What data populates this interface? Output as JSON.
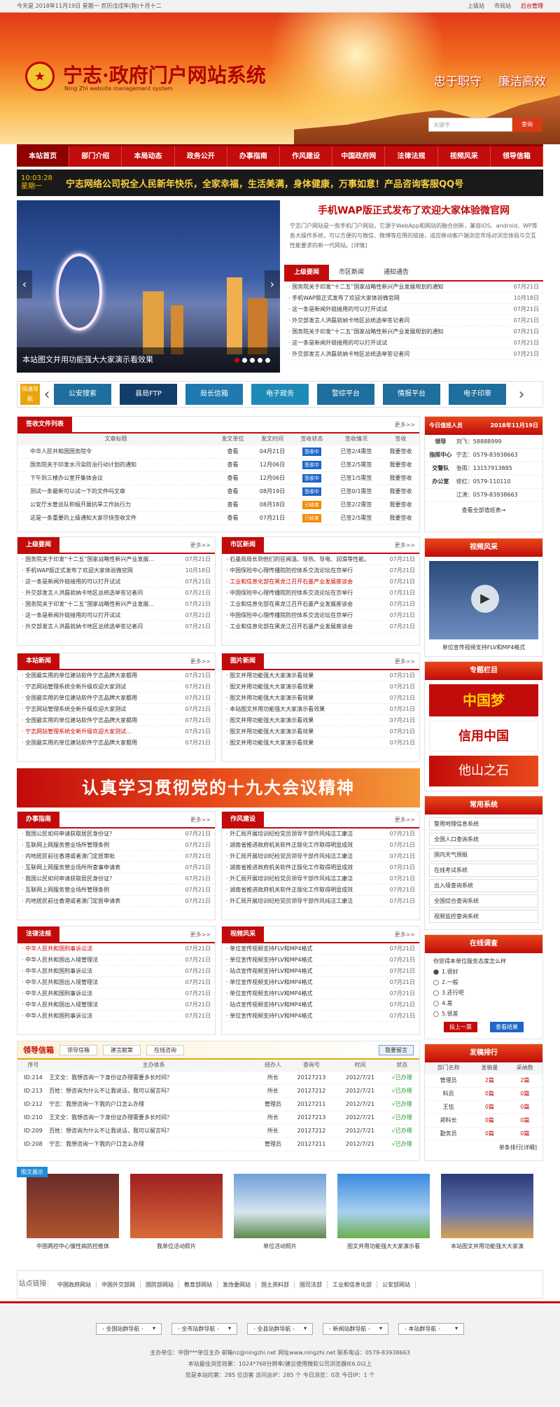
{
  "topbar": {
    "date": "今天是 2018年11月19日 星期一 农历戊戌年(狗)十月十二",
    "links": [
      "上级站",
      "市局站",
      "后台管理"
    ]
  },
  "header": {
    "title": "宁志·政府门户网站系统",
    "subtitle": "Ning Zhi website management system",
    "slogan1": "忠于职守",
    "slogan2": "廉洁高效",
    "search_placeholder": "关键字",
    "search_btn": "查询",
    "emblem": "★"
  },
  "nav": [
    "本站首页",
    "部门介绍",
    "本局动态",
    "政务公开",
    "办事指南",
    "作风建设",
    "中国政府网",
    "法律法规",
    "视频风采",
    "领导信箱"
  ],
  "ticker": {
    "time": "10:03:28",
    "day": "星期一",
    "message": "宁志网络公司祝全人民新年快乐，全家幸福，生活美满，身体健康，万事如意！产品咨询客服QQ号"
  },
  "slider": {
    "caption": "本站图文并用功能强大大家演示看效果",
    "prev": "‹",
    "next": "›"
  },
  "headline": {
    "title": "手机WAP版正式发布了欢迎大家体验微官网",
    "summary": "宁志门户网站是一款手机门户网站，它源于WebApp和网站的融合创新，兼容iOS、android、WP等各大操作系统，可以方便的与微信、微博等应用的链接，适应移动客户端浏览市场对浏览体验与交互性能要求的新一代网站。[详情]"
  },
  "headtabs": [
    "上级要闻",
    "市区新闻",
    "通知通告"
  ],
  "headlist": [
    {
      "t": "国务院关于印发“十二五”国家战略性新兴产业发展规划的通知",
      "d": "07月21日"
    },
    {
      "t": "手机WAP版正式发布了欢迎大家体验微官网",
      "d": "10月18日"
    },
    {
      "t": "这一条是新闻外链接用的可以打开试试",
      "d": "07月21日"
    },
    {
      "t": "外交部发言人洪磊就纳卡地区总统选举答记者问",
      "d": "07月21日"
    },
    {
      "t": "国务院关于印发“十二五”国家战略性新兴产业发展规划的通知",
      "d": "07月21日"
    },
    {
      "t": "这一条是新闻外链接用的可以打开试试",
      "d": "07月21日"
    },
    {
      "t": "外交部发言人洪磊就纳卡地区总统选举答记者问",
      "d": "07月21日"
    }
  ],
  "quick": {
    "label": "快速导航",
    "prev": "‹",
    "next": "›",
    "items": [
      "公安搜索",
      "县局FTP",
      "局长信箱",
      "电子政务",
      "警综平台",
      "情报平台",
      "电子印章"
    ]
  },
  "docs": {
    "title": "签收文件列表",
    "more": "更多>>",
    "cols": [
      "文章标题",
      "发文单位",
      "发文时间",
      "签收状态",
      "签收情况",
      "签收"
    ],
    "rows": [
      {
        "t": "中华人民共和国国务院令",
        "u": "查看",
        "d": "04月21日",
        "s": "签收中",
        "c": "已签2/4需签",
        "a": "我要签收",
        "sc": "#1e66c8"
      },
      {
        "t": "国务院关于印发水污染防治行动计划的通知",
        "u": "查看",
        "d": "12月06日",
        "s": "签收中",
        "c": "已签2/5需签",
        "a": "我要签收",
        "sc": "#1e66c8"
      },
      {
        "t": "下午到三楼办公室开集体会议",
        "u": "查看",
        "d": "12月06日",
        "s": "签收中",
        "c": "已签1/5需签",
        "a": "我要签收",
        "sc": "#1e66c8"
      },
      {
        "t": "测试一条最新可以试一下的文件吗文章",
        "u": "查看",
        "d": "08月19日",
        "s": "签收中",
        "c": "已签0/1需签",
        "a": "我要签收",
        "sc": "#1e66c8"
      },
      {
        "t": "公安厅水管总队积极开展抗旱工作执行力",
        "u": "查看",
        "d": "08月18日",
        "s": "已结束",
        "c": "已签2/2需签",
        "a": "我要签收",
        "sc": "#f08a00"
      },
      {
        "t": "这是一条重要的上级通知大家尽快签收文件",
        "u": "查看",
        "d": "07月21日",
        "s": "已结束",
        "c": "已签2/5需签",
        "a": "我要签收",
        "sc": "#f08a00"
      }
    ]
  },
  "duty": {
    "title": "今日值班人员",
    "date": "2018年11月19日",
    "more": "查看全部值班表→",
    "rows": [
      [
        "领导",
        "刘飞：58888999"
      ],
      [
        "指挥中心",
        "宁志：0579-83938663"
      ],
      [
        "交警队",
        "张雨：13157913885"
      ],
      [
        "办公室",
        "徐红：0579-110110"
      ],
      [
        "",
        "江涛：0579-83938663"
      ]
    ]
  },
  "sec1": {
    "title": "上级要闻",
    "more": "更多>>",
    "items": [
      {
        "t": "国务院关于印发“十二五”国家战略性新兴产业发展...",
        "d": "07月21日"
      },
      {
        "t": "手机WAP版正式发布了欢迎大家体验微官网",
        "d": "10月18日"
      },
      {
        "t": "这一条是新闻外链接用的可以打开试试",
        "d": "07月21日"
      },
      {
        "t": "外交部发言人洪磊就纳卡地区总统选举答记者问",
        "d": "07月21日"
      },
      {
        "t": "国务院关于印发“十二五”国家战略性新兴产业发展...",
        "d": "07月21日"
      },
      {
        "t": "这一条是新闻外链接用的可以打开试试",
        "d": "07月21日"
      },
      {
        "t": "外交部发言人洪磊就纳卡地区总统选举答记者问",
        "d": "07月21日"
      }
    ]
  },
  "sec2": {
    "title": "市区新闻",
    "more": "更多>>",
    "items": [
      {
        "t": "石墨局局长到他们的驻闻温、导热、导电、润滑等性能。",
        "d": "07月21日"
      },
      {
        "t": "中国保险中心理传播院防控体系交流论坛在京举行",
        "d": "07月21日"
      },
      {
        "t": "工业和信息化部在黑龙江召开石墨产业发展座谈会",
        "d": "07月21日",
        "red": true
      },
      {
        "t": "中国保险中心理传播院防控体系交流论坛在京举行",
        "d": "07月21日"
      },
      {
        "t": "工业和信息化部在黑龙江召开石墨产业发展座谈会",
        "d": "07月21日"
      },
      {
        "t": "中国保险中心理传播院防控体系交流论坛在京举行",
        "d": "07月21日"
      },
      {
        "t": "工业和信息化部在黑龙江召开石墨产业发展座谈会",
        "d": "07月21日"
      }
    ]
  },
  "sec3": {
    "title": "本站新闻",
    "more": "更多>>",
    "items": [
      {
        "t": "全国最实用的单位建站软件宁志品牌大家都用",
        "d": "07月21日"
      },
      {
        "t": "宁志网站管理系统全新升级欢迎大家测试",
        "d": "07月21日"
      },
      {
        "t": "全国最实用的单位建站软件宁志品牌大家都用",
        "d": "07月21日"
      },
      {
        "t": "宁志网站管理系统全新升级欢迎大家测试",
        "d": "07月21日"
      },
      {
        "t": "全国最实用的单位建站软件宁志品牌大家都用",
        "d": "07月21日"
      },
      {
        "t": "宁志网站管理系统全新升级欢迎大家测试...",
        "d": "07月21日",
        "red": true
      },
      {
        "t": "全国最实用的单位建站软件宁志品牌大家都用",
        "d": "07月21日"
      }
    ]
  },
  "sec4": {
    "title": "图片新闻",
    "more": "更多>>",
    "items": [
      {
        "t": "图文并用功能强大大家演示看效果",
        "d": "07月21日"
      },
      {
        "t": "图文并用功能强大大家演示看效果",
        "d": "07月21日"
      },
      {
        "t": "图文并用功能强大大家演示看效果",
        "d": "07月21日"
      },
      {
        "t": "本站图文并用功能强大大家演示看效果",
        "d": "07月21日"
      },
      {
        "t": "图文并用功能强大大家演示看效果",
        "d": "07月21日"
      },
      {
        "t": "图文并用功能强大大家演示看效果",
        "d": "07月21日"
      },
      {
        "t": "图文并用功能强大大家演示看效果",
        "d": "07月21日"
      }
    ]
  },
  "banner": "认真学习贯彻党的十九大会议精神",
  "video": {
    "title": "视频风采",
    "caption": "单位宣传视频支持FLV和MP4格式",
    "play": "▶"
  },
  "topics": {
    "title": "专题栏目",
    "items": [
      "中国梦",
      "信用中国",
      "他山之石"
    ]
  },
  "systems": {
    "title": "常用系统",
    "items": [
      "警用地理信息系统",
      "全国人口查询系统",
      "国内天气预报",
      "在线考试系统",
      "出入境查询系统",
      "全国综合查询系统",
      "视频监控查询系统"
    ]
  },
  "sec5": {
    "title": "办事指南",
    "more": "更多>>",
    "items": [
      {
        "t": "我国公民如何申请获取居民身份证？",
        "d": "07月21日"
      },
      {
        "t": "互联网上网服务营业场所管理条例",
        "d": "07月21日"
      },
      {
        "t": "内地居民前往香港或者澳门定居审批",
        "d": "07月21日"
      },
      {
        "t": "互联网上网服务营业场所所查事申请表",
        "d": "07月21日"
      },
      {
        "t": "我国公民如何申请获取居民身份证？",
        "d": "07月21日"
      },
      {
        "t": "互联网上网服务营业场所管理条例",
        "d": "07月21日"
      },
      {
        "t": "内地居民前往香港或者澳门定居申请表",
        "d": "07月21日"
      }
    ]
  },
  "sec6": {
    "title": "作风建设",
    "more": "更多>>",
    "items": [
      {
        "t": "外汇局开展培训纪检党员领导干部作风纯洁工康洁",
        "d": "07月21日"
      },
      {
        "t": "湖南省推进政府机关软件正版化工作取得明显成效",
        "d": "07月21日"
      },
      {
        "t": "外汇局开展培训纪检党员领导干部作风纯洁工康洁",
        "d": "07月21日"
      },
      {
        "t": "湖南省推进政府机关软件正版化工作取得明显成效",
        "d": "07月21日"
      },
      {
        "t": "外汇局开展培训纪检党员领导干部作风纯洁工康洁",
        "d": "07月21日"
      },
      {
        "t": "湖南省推进政府机关软件正版化工作取得明显成效",
        "d": "07月21日"
      },
      {
        "t": "外汇局开展培训纪检党员领导干部作风纯洁工康洁",
        "d": "07月21日"
      }
    ]
  },
  "sec7": {
    "title": "法律法规",
    "more": "更多>>",
    "items": [
      {
        "t": "中华人民共和国刑事诉讼法",
        "d": "07月21日",
        "red": true
      },
      {
        "t": "中华人民共和国出入境管理法",
        "d": "07月21日"
      },
      {
        "t": "中华人民共和国刑事诉讼法",
        "d": "07月21日"
      },
      {
        "t": "中华人民共和国出入境管理法",
        "d": "07月21日"
      },
      {
        "t": "中华人民共和国刑事诉讼法",
        "d": "07月21日"
      },
      {
        "t": "中华人民共和国出入境管理法",
        "d": "07月21日"
      },
      {
        "t": "中华人民共和国刑事诉讼法",
        "d": "07月21日"
      }
    ]
  },
  "sec8": {
    "title": "视频风采",
    "more": "更多>>",
    "items": [
      {
        "t": "单位宣传视频支持FLV和MP4格式",
        "d": "07月21日"
      },
      {
        "t": "单位宣传视频支持FLV和MP4格式",
        "d": "07月21日"
      },
      {
        "t": "站点宣传视频支持FLV和MP4格式",
        "d": "07月21日"
      },
      {
        "t": "单位宣传视频支持FLV和MP4格式",
        "d": "07月21日"
      },
      {
        "t": "单位宣传视频支持FLV和MP4格式",
        "d": "07月21日"
      },
      {
        "t": "站点宣传视频支持FLV和MP4格式",
        "d": "07月21日"
      },
      {
        "t": "单位宣传视频支持FLV和MP4格式",
        "d": "07月21日"
      }
    ]
  },
  "survey": {
    "title": "在线调查",
    "question": "你觉得本单位服务态度怎么样",
    "options": [
      "1.很好",
      "2.一般",
      "3.还行吧",
      "4.差",
      "5.很差"
    ],
    "submit": "投上一票",
    "view": "查看结果"
  },
  "mailbox": {
    "title": "领导信箱",
    "tabs": [
      "领导信箱",
      "建言献策",
      "在线咨询"
    ],
    "write": "我要留言",
    "cols": [
      "序号",
      "主办体系",
      "结办人",
      "查询号",
      "时间",
      "状态"
    ],
    "rows": [
      [
        "ID:214",
        "王文全：我想咨询一下身份证办理需要多长时间？",
        "所长",
        "20127213",
        "2012/7/21",
        "√已办理"
      ],
      [
        "ID:213",
        "百姓：想咨询为什么不让我说话，我可以留言吗？",
        "所长",
        "20127212",
        "2012/7/21",
        "√已办理"
      ],
      [
        "ID:212",
        "宁志：我想咨询一下我的户口怎么办理",
        "管理员",
        "20127211",
        "2012/7/21",
        "√已办理"
      ],
      [
        "ID:210",
        "王文全：我想咨询一下身份证办理需要多长时间？",
        "所长",
        "20127213",
        "2012/7/21",
        "√已办理"
      ],
      [
        "ID:209",
        "百姓：想咨询为什么不让我说话，我可以留言吗？",
        "所长",
        "20127212",
        "2012/7/21",
        "√已办理"
      ],
      [
        "ID:208",
        "宁志：我想咨询一下我的户口怎么办理",
        "管理员",
        "20127211",
        "2012/7/21",
        "√已办理"
      ]
    ]
  },
  "ranking": {
    "title": "发稿排行",
    "cols": [
      "部门名称",
      "发稿量",
      "采纳数"
    ],
    "rows": [
      [
        "管理员",
        "2篇",
        "2篇"
      ],
      [
        "科员",
        "0篇",
        "0篇"
      ],
      [
        "王伍",
        "0篇",
        "0篇"
      ],
      [
        "郑科长",
        "0篇",
        "0篇"
      ],
      [
        "勤务员",
        "0篇",
        "0篇"
      ]
    ],
    "more": "单条排行[详细]"
  },
  "photos": {
    "badge": "图文展示",
    "items": [
      "中国两控中心慢性病防控推体",
      "我单位活动照片",
      "单位活动照片",
      "图文并用功能强大大家演示看",
      "本站图文并用功能强大大家演"
    ]
  },
  "links": {
    "label": "站点链接",
    "items": [
      "中国政府网站",
      "中国外交部网",
      "国防部网站",
      "教育部网站",
      "发改委网站",
      "国土资料部",
      "国司法部",
      "工业和信息化部",
      "公安部网站"
    ]
  },
  "footer": {
    "selects": [
      "- 全国站群导航 -",
      "- 全市站群导航 -",
      "- 全县站群导航 -",
      "- 新闻站群导航 -",
      "- 本站群导航 -"
    ],
    "line1": "主办单位：中国***单位主办 邮箱nz@ningzhi.net 网址www.ningzhi.net 联系电话：0579-83938663",
    "line2": "本站最佳浏览效果：1024*768分辨率/建议使用微软公司浏览器IE6.0以上",
    "line3": "您是本站的第：285 位访客 访问总IP：285 个 今日浏览：0次 今日IP：1 个"
  },
  "colors": {
    "brand": "#c20b0b",
    "accent": "#e9a50d",
    "quick_btn": "#1e6e9e"
  }
}
